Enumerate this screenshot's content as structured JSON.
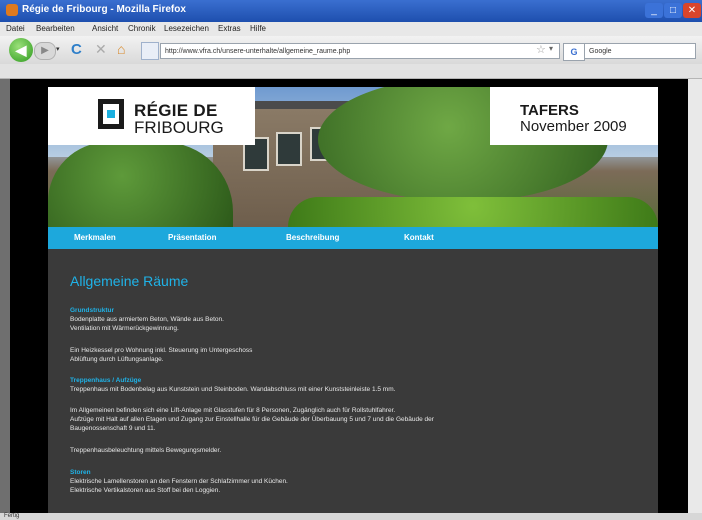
{
  "window": {
    "title": "Régie de Fribourg - Mozilla Firefox",
    "min": "_",
    "max": "□",
    "close": "✕"
  },
  "menu": [
    "Datei",
    "Bearbeiten",
    "Ansicht",
    "Chronik",
    "Lesezeichen",
    "Extras",
    "Hilfe"
  ],
  "nav": {
    "back": "◀",
    "forward": "▶",
    "history": "▾",
    "reload": "C",
    "stop": "✕",
    "home": "⌂",
    "url": "http://www.vfra.ch/unsere-unterhalte/allgemeine_raume.php",
    "star": "☆",
    "url_dropdown": "▾",
    "search_engine": "G",
    "search_placeholder": "Google"
  },
  "status": "Fertig",
  "site": {
    "logo_line1": "RÉGIE DE",
    "logo_line2": "FRIBOURG",
    "event_line1": "TAFERS",
    "event_line2": "November 2009",
    "nav_links": [
      "Merkmalen",
      "Präsentation",
      "Beschreibung",
      "Kontakt"
    ],
    "heading": "Allgemeine Räume",
    "sections": [
      {
        "title": "Grundstruktur",
        "lines": [
          "Bodenplatte aus armiertem Beton, Wände aus Beton.",
          "Ventilation mit Wärmerückgewinnung."
        ]
      },
      {
        "title": "",
        "lines": [
          "Ein Heizkessel pro Wohnung inkl. Steuerung im Untergeschoss",
          "Ablüftung durch Lüftungsanlage."
        ]
      },
      {
        "title": "Treppenhaus / Aufzüge",
        "lines": [
          "Treppenhaus mit Bodenbelag aus Kunststein und Steinboden. Wandabschluss mit einer Kunststeinleiste 1.5 mm."
        ]
      },
      {
        "title": "",
        "lines": [
          "Im Allgemeinen befinden sich eine Lift-Anlage mit Glasstufen für 8 Personen, Zugänglich auch für Rollstuhlfahrer.",
          "Aufzüge mit Halt auf allen Etagen und Zugang zur Einstellhalle für die Gebäude der Überbauung 5 und 7 und die Gebäude der",
          "Baugenossenschaft 9 und 11."
        ]
      },
      {
        "title": "",
        "lines": [
          "Treppenhausbeleuchtung mittels Bewegungsmelder."
        ]
      },
      {
        "title": "Storen",
        "lines": [
          "Elektrische Lamellenstoren an den Fenstern der Schlafzimmer und Küchen.",
          "Elektrische Vertikalstoren aus Stoff bei den Loggien."
        ]
      }
    ]
  }
}
